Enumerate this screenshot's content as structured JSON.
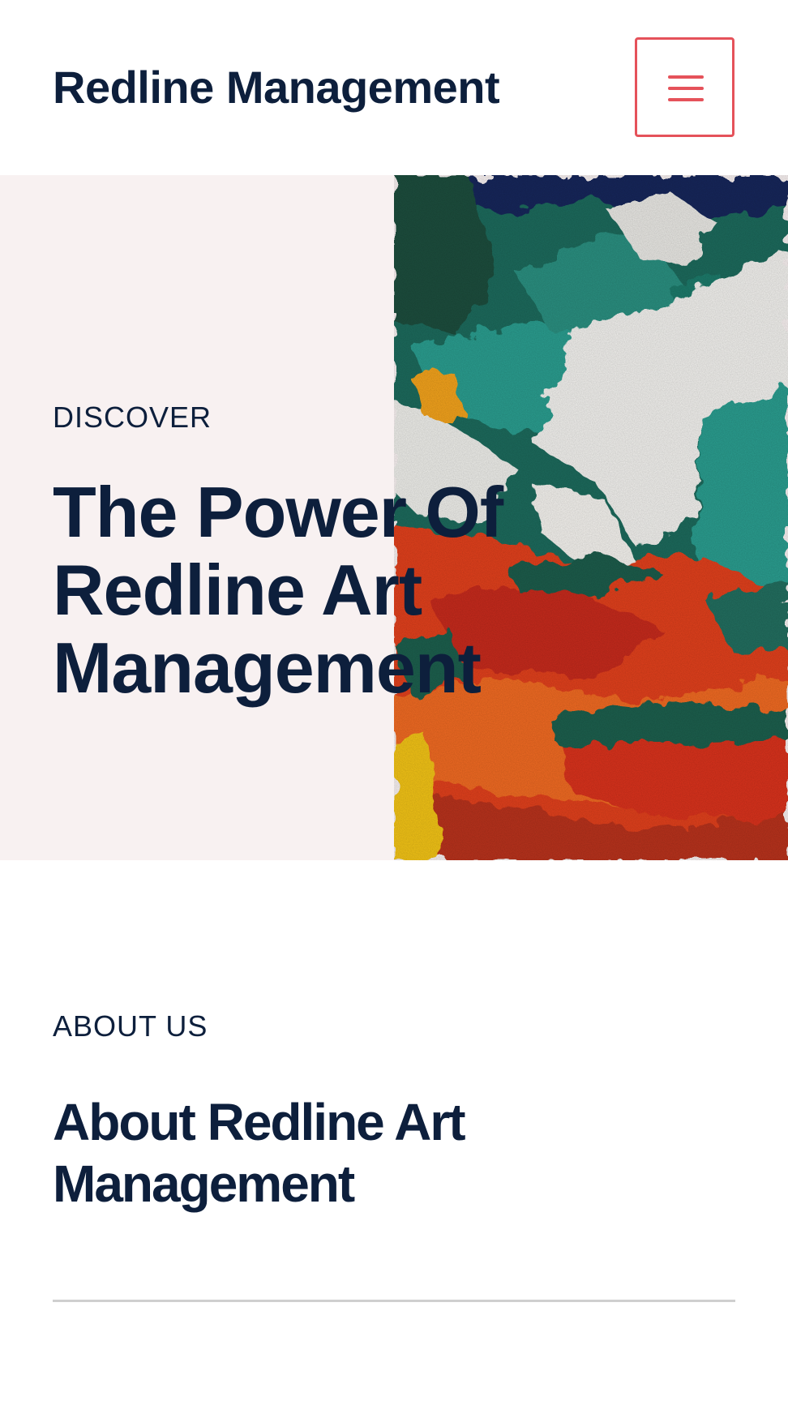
{
  "header": {
    "site_title": "Redline Management",
    "menu_icon": "hamburger-menu-icon",
    "accent_color": "#e5525a"
  },
  "hero": {
    "eyebrow": "DISCOVER",
    "heading": "The Power Of Redline Art Management",
    "background_color": "#f8f1f1",
    "image": "abstract-painting"
  },
  "about": {
    "eyebrow": "ABOUT US",
    "heading": "About Redline Art Management"
  },
  "colors": {
    "text": "#0d1f3c",
    "divider": "#cfcfcf"
  }
}
